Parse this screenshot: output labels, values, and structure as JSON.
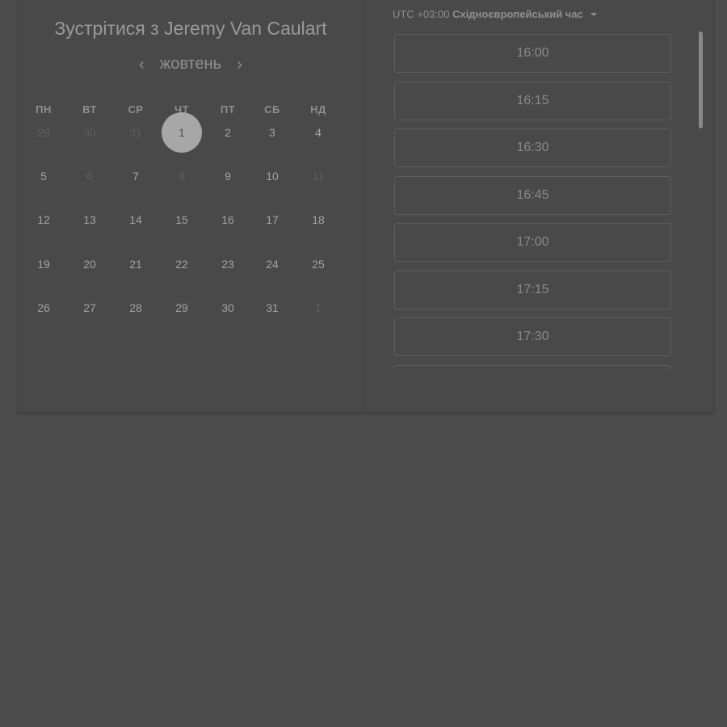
{
  "header": {
    "title_prefix": "Зустрітися з",
    "host_name": "Jeremy Van Caulart"
  },
  "calendar": {
    "month_label": "жовтень",
    "prev_icon": "chevron-left-icon",
    "next_icon": "chevron-right-icon",
    "prev_glyph": "‹",
    "next_glyph": "›",
    "weekdays": [
      "ПН",
      "ВТ",
      "СР",
      "ЧТ",
      "ПТ",
      "СБ",
      "НД"
    ],
    "weeks": [
      [
        {
          "d": "29",
          "muted": true
        },
        {
          "d": "30",
          "muted": true
        },
        {
          "d": "31",
          "muted": true
        },
        {
          "d": "1",
          "selected": true
        },
        {
          "d": "2"
        },
        {
          "d": "3"
        },
        {
          "d": "4"
        }
      ],
      [
        {
          "d": "5"
        },
        {
          "d": "6",
          "muted": true
        },
        {
          "d": "7"
        },
        {
          "d": "8",
          "muted": true
        },
        {
          "d": "9"
        },
        {
          "d": "10"
        },
        {
          "d": "11",
          "muted": true
        }
      ],
      [
        {
          "d": "12"
        },
        {
          "d": "13"
        },
        {
          "d": "14"
        },
        {
          "d": "15"
        },
        {
          "d": "16"
        },
        {
          "d": "17"
        },
        {
          "d": "18"
        }
      ],
      [
        {
          "d": "19"
        },
        {
          "d": "20"
        },
        {
          "d": "21"
        },
        {
          "d": "22"
        },
        {
          "d": "23"
        },
        {
          "d": "24"
        },
        {
          "d": "25"
        }
      ],
      [
        {
          "d": "26"
        },
        {
          "d": "27"
        },
        {
          "d": "28"
        },
        {
          "d": "29"
        },
        {
          "d": "30"
        },
        {
          "d": "31"
        },
        {
          "d": "1",
          "muted": true
        }
      ]
    ]
  },
  "timezone": {
    "offset": "UTC +03:00",
    "name": "Східноєвропейський час",
    "icon": "caret-down-icon"
  },
  "time_slots": [
    "16:00",
    "16:15",
    "16:30",
    "16:45",
    "17:00",
    "17:15",
    "17:30",
    ""
  ],
  "colors": {
    "overlay": "#4c4c4c",
    "card": "#494949",
    "selected_day": "#a7a7a7",
    "slot_border": "#5e5e5e"
  }
}
